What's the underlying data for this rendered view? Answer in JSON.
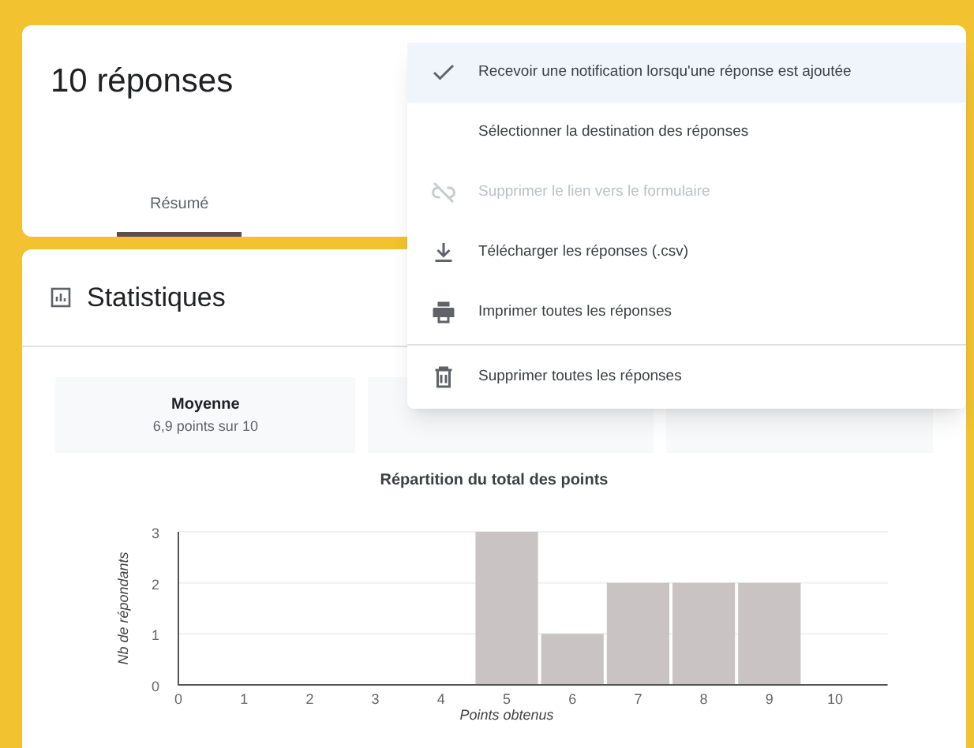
{
  "header": {
    "title": "10 réponses",
    "tabs": [
      {
        "label": "Résumé",
        "selected": true
      }
    ]
  },
  "menu": {
    "items": [
      {
        "kind": "check",
        "label": "Recevoir une notification lorsqu'une réponse est ajoutée",
        "checked": true,
        "disabled": false
      },
      {
        "kind": "plain",
        "label": "Sélectionner la destination des réponses",
        "disabled": false
      },
      {
        "kind": "unlink",
        "label": "Supprimer le lien vers le formulaire",
        "disabled": true
      },
      {
        "kind": "download",
        "label": "Télécharger les réponses (.csv)",
        "disabled": false
      },
      {
        "kind": "print",
        "label": "Imprimer toutes les réponses",
        "disabled": false
      },
      {
        "kind": "delete",
        "label": "Supprimer toutes les réponses",
        "disabled": false
      }
    ]
  },
  "stats": {
    "title": "Statistiques",
    "cards": [
      {
        "label": "Moyenne",
        "value": "6,9 points sur 10"
      }
    ],
    "chart_title": "Répartition du total des points",
    "chart_data": {
      "type": "bar",
      "xlabel": "Points obtenus",
      "ylabel": "Nb de répondants",
      "categories": [
        "0",
        "1",
        "2",
        "3",
        "4",
        "5",
        "6",
        "7",
        "8",
        "9",
        "10"
      ],
      "series": [
        {
          "color": "#c9c4c3",
          "values": [
            0,
            0,
            0,
            0,
            0,
            3,
            1,
            2,
            2,
            2,
            0
          ]
        }
      ],
      "ylim": [
        0,
        3
      ],
      "yticks": [
        0,
        1,
        2,
        3
      ]
    }
  }
}
